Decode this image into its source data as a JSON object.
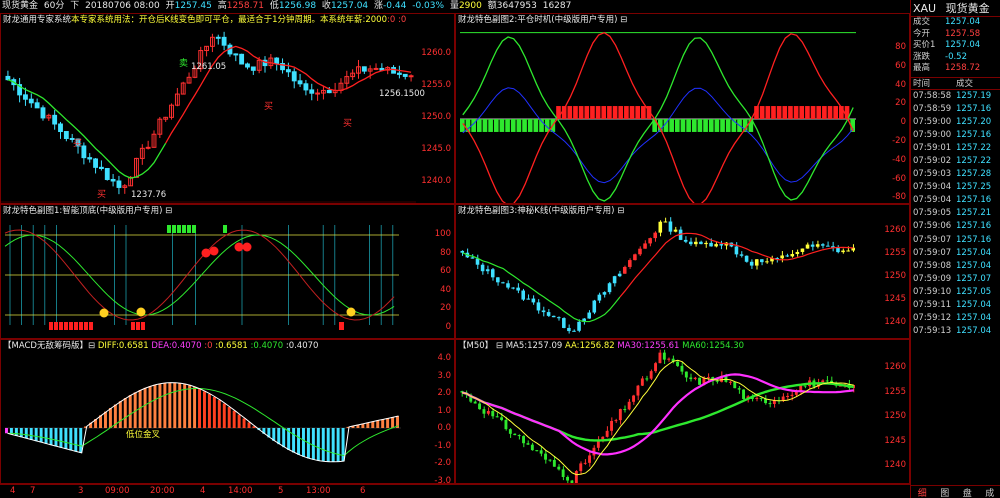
{
  "top_bar": {
    "symbol": "现货黄金",
    "period": "60分",
    "period_suffix": "下",
    "datetime": "20180706 08:00",
    "open_label": "开",
    "open": "1257.45",
    "high_label": "高",
    "high": "1258.71",
    "low_label": "低",
    "low": "1256.98",
    "close_label": "收",
    "close": "1257.04",
    "change_label": "涨",
    "change": "-0.44",
    "change_pct": "-0.03%",
    "volume_label": "量",
    "volume": "2900",
    "amount_label": "额",
    "amount": "3647953",
    "extra": "16287"
  },
  "panels": {
    "main": {
      "title_prefix": "财龙通用专家系统",
      "title_rule": "本专家系统用法：开仓后K线变色即可平仓，最适合于1分钟周期。本系统年薪:2000",
      "title_suffix": ":0 :0",
      "y_labels": [
        "1260.0",
        "1255.0",
        "1250.0",
        "1245.0",
        "1240.0"
      ],
      "annotations": {
        "high_label": "1261.05",
        "low_label": "1237.76",
        "last_label": "1256.1500",
        "buy": "买",
        "sell": "卖"
      }
    },
    "sub2": {
      "title": "财龙特色副图2:平仓时机(中级版用户专用)",
      "icon": "⊟",
      "y_labels": [
        "80",
        "60",
        "40",
        "20",
        "0",
        "-20",
        "-40",
        "-60",
        "-80"
      ]
    },
    "sub1": {
      "title": "财龙特色副图1:智能顶底(中级版用户专用)",
      "icon": "⊟",
      "y_labels": [
        "100",
        "80",
        "60",
        "40",
        "20",
        "0"
      ]
    },
    "sub3": {
      "title": "财龙特色副图3:神秘K线(中级版用户专用)",
      "icon": "⊟",
      "y_labels": [
        "1260",
        "1255",
        "1250",
        "1245",
        "1240"
      ]
    },
    "macd": {
      "title": "【MACD无敌筹码版】",
      "icon": "⊟",
      "diff_label": "DIFF:",
      "diff": "0.6581",
      "dea_label": "DEA:",
      "dea": "0.4070",
      "v1": ":0",
      "v2": ":0.6581",
      "v3": ":0.4070",
      "v4": ":0.4070",
      "y_labels": [
        "4.0",
        "3.0",
        "2.0",
        "1.0",
        "0.0",
        "-1.0",
        "-2.0",
        "-3.0"
      ],
      "annotation": "低位金叉"
    },
    "ma": {
      "title": "【M50】",
      "icon": "⊟",
      "ma5_label": "MA5:",
      "ma5": "1257.09",
      "aa_label": "AA:",
      "aa": "1256.82",
      "ma30_label": "MA30:",
      "ma30": "1255.61",
      "ma60_label": "MA60:",
      "ma60": "1254.30",
      "y_labels": [
        "1260",
        "1255",
        "1250",
        "1245",
        "1240"
      ]
    }
  },
  "x_axis": [
    "4",
    "7",
    "3",
    "09:00",
    "20:00",
    "4",
    "14:00",
    "5",
    "13:00",
    "6"
  ],
  "quote": {
    "code": "XAU",
    "name": "现货黄金",
    "rows": [
      {
        "label": "成交",
        "value": "1257.04",
        "color": "#3fe0ff"
      },
      {
        "label": "今开",
        "value": "1257.58",
        "color": "#ff4040"
      },
      {
        "label": "买价1",
        "value": "1257.04",
        "color": "#3fe0ff"
      },
      {
        "label": "涨跌",
        "value": "-0.52",
        "color": "#3fe0ff"
      },
      {
        "label": "最高",
        "value": "1258.72",
        "color": "#ff4040"
      }
    ],
    "tick_header_time": "时间",
    "tick_header_price": "成交",
    "ticks": [
      {
        "time": "07:58:58",
        "price": "1257.19"
      },
      {
        "time": "07:58:59",
        "price": "1257.16"
      },
      {
        "time": "07:59:00",
        "price": "1257.20"
      },
      {
        "time": "07:59:00",
        "price": "1257.16"
      },
      {
        "time": "07:59:01",
        "price": "1257.22"
      },
      {
        "time": "07:59:02",
        "price": "1257.22"
      },
      {
        "time": "07:59:03",
        "price": "1257.28"
      },
      {
        "time": "07:59:04",
        "price": "1257.25"
      },
      {
        "time": "07:59:04",
        "price": "1257.16"
      },
      {
        "time": "07:59:05",
        "price": "1257.21"
      },
      {
        "time": "07:59:06",
        "price": "1257.16"
      },
      {
        "time": "07:59:07",
        "price": "1257.16"
      },
      {
        "time": "07:59:07",
        "price": "1257.04"
      },
      {
        "time": "07:59:08",
        "price": "1257.04"
      },
      {
        "time": "07:59:09",
        "price": "1257.07"
      },
      {
        "time": "07:59:10",
        "price": "1257.05"
      },
      {
        "time": "07:59:11",
        "price": "1257.04"
      },
      {
        "time": "07:59:12",
        "price": "1257.04"
      },
      {
        "time": "07:59:13",
        "price": "1257.04"
      }
    ],
    "tabs": [
      "细",
      "图",
      "盘",
      "成"
    ]
  },
  "colors": {
    "border": "#7a0000",
    "up": "#ff3030",
    "down": "#3fe0ff",
    "label": "#ff3030"
  }
}
